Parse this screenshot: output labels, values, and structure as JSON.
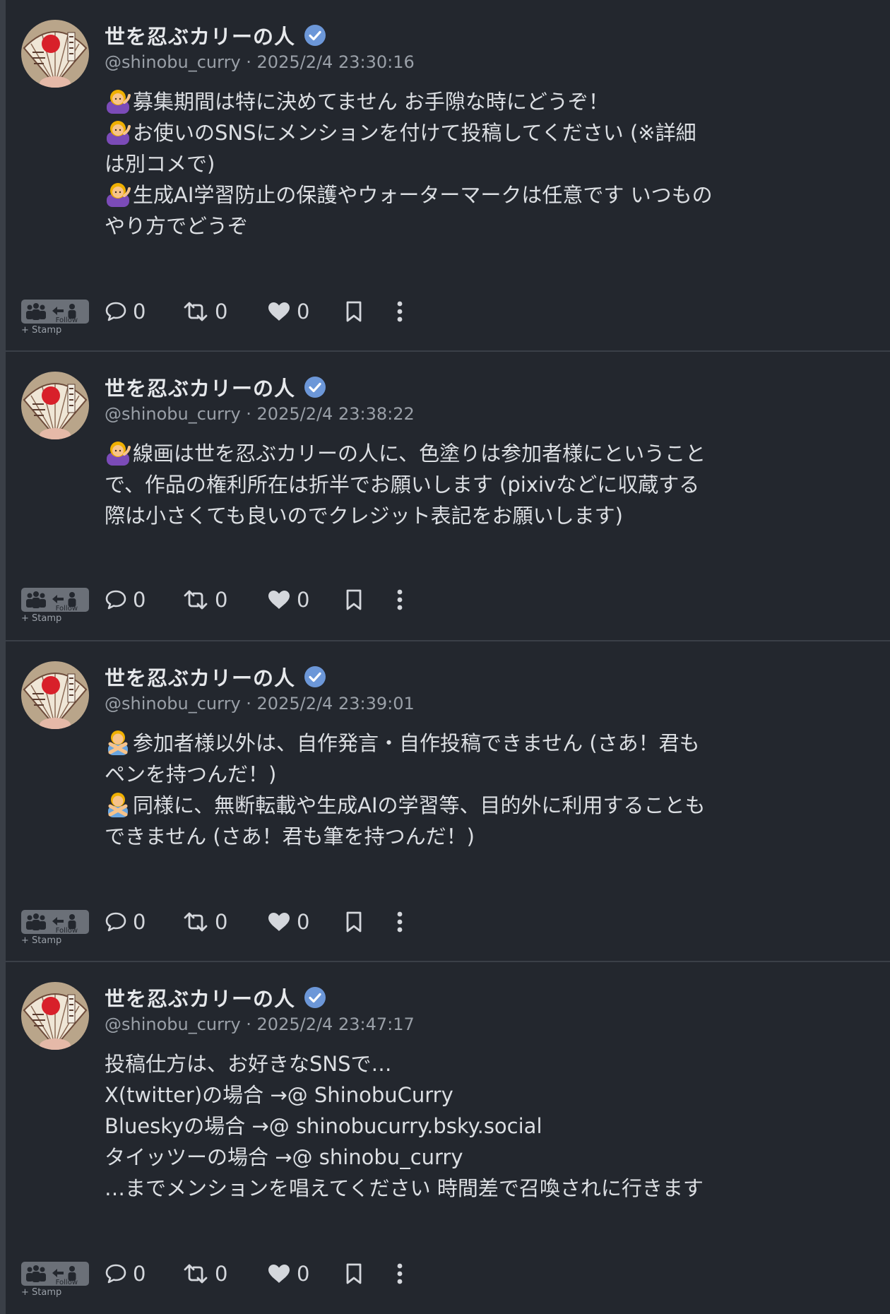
{
  "colors": {
    "background": "#23272e",
    "divider": "#3a3f47",
    "verified_badge": "#6c97d8",
    "text": "#dcdfe3",
    "muted": "#9aa0a8"
  },
  "icons": [
    "user-avatar",
    "verified-icon",
    "people-stamp-icon",
    "reply-icon",
    "renote-icon",
    "heart-icon",
    "bookmark-icon",
    "more-vertical-icon"
  ],
  "posts": [
    {
      "display_name": "世を忍ぶカリーの人",
      "meta": "@shinobu_curry · 2025/2/4 23:30:16",
      "lines": [
        {
          "emoji": "woman-tipping-hand",
          "text": "募集期間は特に決めてません お手隙な時にどうぞ！"
        },
        {
          "emoji": "woman-tipping-hand",
          "text": "お使いのSNSにメンションを付けて投稿してください (※詳細"
        },
        {
          "emoji": "",
          "text": "は別コメで)"
        },
        {
          "emoji": "woman-tipping-hand",
          "text": "生成AI学習防止の保護やウォーターマークは任意です いつもの"
        },
        {
          "emoji": "",
          "text": "やり方でどうぞ"
        }
      ],
      "replies": "0",
      "renotes": "0",
      "likes": "0",
      "stamp_follow": "Follow",
      "stamp_label": "+ Stamp"
    },
    {
      "display_name": "世を忍ぶカリーの人",
      "meta": "@shinobu_curry · 2025/2/4 23:38:22",
      "lines": [
        {
          "emoji": "woman-tipping-hand",
          "text": "線画は世を忍ぶカリーの人に、色塗りは参加者様にということ"
        },
        {
          "emoji": "",
          "text": "で、作品の権利所在は折半でお願いします (pixivなどに収蔵する"
        },
        {
          "emoji": "",
          "text": "際は小さくても良いのでクレジット表記をお願いします)"
        }
      ],
      "replies": "0",
      "renotes": "0",
      "likes": "0",
      "stamp_follow": "Follow",
      "stamp_label": "+ Stamp"
    },
    {
      "display_name": "世を忍ぶカリーの人",
      "meta": "@shinobu_curry · 2025/2/4 23:39:01",
      "lines": [
        {
          "emoji": "person-gesturing-no",
          "text": "参加者様以外は、自作発言・自作投稿できません (さあ！君も"
        },
        {
          "emoji": "",
          "text": "ペンを持つんだ！)"
        },
        {
          "emoji": "person-gesturing-no",
          "text": "同様に、無断転載や生成AIの学習等、目的外に利用することも"
        },
        {
          "emoji": "",
          "text": "できません (さあ！君も筆を持つんだ！)"
        }
      ],
      "replies": "0",
      "renotes": "0",
      "likes": "0",
      "stamp_follow": "Follow",
      "stamp_label": "+ Stamp"
    },
    {
      "display_name": "世を忍ぶカリーの人",
      "meta": "@shinobu_curry · 2025/2/4 23:47:17",
      "lines": [
        {
          "emoji": "",
          "text": "投稿仕方は、お好きなSNSで…"
        },
        {
          "emoji": "",
          "text": "X(twitter)の場合 →@ ShinobuCurry"
        },
        {
          "emoji": "",
          "text": "Blueskyの場合 →@ shinobucurry.bsky.social"
        },
        {
          "emoji": "",
          "text": "タイッツーの場合 →@ shinobu_curry"
        },
        {
          "emoji": "",
          "text": "…までメンションを唱えてください 時間差で召喚されに行きます"
        }
      ],
      "replies": "0",
      "renotes": "0",
      "likes": "0",
      "stamp_follow": "Follow",
      "stamp_label": "+ Stamp"
    }
  ]
}
